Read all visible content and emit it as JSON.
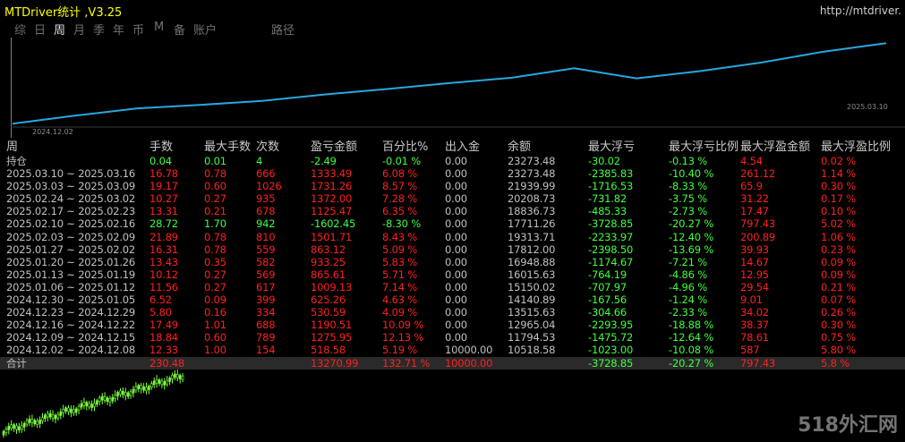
{
  "app": {
    "title": "MTDriver统计 ,V3.25",
    "url": "http://mtdriver."
  },
  "tabs": [
    "综",
    "日",
    "周",
    "月",
    "季",
    "年",
    "币",
    "M",
    "备",
    "账户",
    "路径"
  ],
  "equity_chart": {
    "start_date": "2024.12.02",
    "end_date": "2025.03.10",
    "values": [
      10518.58,
      11794.53,
      12965.04,
      13515.63,
      14140.89,
      15150.02,
      16015.63,
      16948.88,
      17812.0,
      19313.71,
      17711.26,
      18836.73,
      20208.73,
      21939.99,
      23273.48
    ]
  },
  "headers": [
    "周",
    "手数",
    "最大手数",
    "次数",
    "盈亏金额",
    "百分比%",
    "出入金",
    "余额",
    "最大浮亏",
    "最大浮亏比例",
    "最大浮盈金额",
    "最大浮盈比例"
  ],
  "rows": [
    {
      "label": "持仓",
      "v": [
        "0.04",
        "0.01",
        "4",
        "-2.49",
        "-0.01 %",
        "0.00",
        "23273.48",
        "-30.02",
        "-0.13 %",
        "4.54",
        "0.02 %"
      ]
    },
    {
      "label": "2025.03.10 ~ 2025.03.16",
      "v": [
        "16.78",
        "0.78",
        "666",
        "1333.49",
        "6.08 %",
        "0.00",
        "23273.48",
        "-2385.83",
        "-10.40 %",
        "261.12",
        "1.14 %"
      ]
    },
    {
      "label": "2025.03.03 ~ 2025.03.09",
      "v": [
        "19.17",
        "0.60",
        "1026",
        "1731.26",
        "8.57 %",
        "0.00",
        "21939.99",
        "-1716.53",
        "-8.33 %",
        "65.9",
        "0.30 %"
      ]
    },
    {
      "label": "2025.02.24 ~ 2025.03.02",
      "v": [
        "10.27",
        "0.27",
        "935",
        "1372.00",
        "7.28 %",
        "0.00",
        "20208.73",
        "-731.82",
        "-3.75 %",
        "31.22",
        "0.17 %"
      ]
    },
    {
      "label": "2025.02.17 ~ 2025.02.23",
      "v": [
        "13.31",
        "0.21",
        "678",
        "1125.47",
        "6.35 %",
        "0.00",
        "18836.73",
        "-485.33",
        "-2.73 %",
        "17.47",
        "0.10 %"
      ]
    },
    {
      "label": "2025.02.10 ~ 2025.02.16",
      "v": [
        "28.72",
        "1.70",
        "942",
        "-1602.45",
        "-8.30 %",
        "0.00",
        "17711.26",
        "-3728.85",
        "-20.27 %",
        "797.43",
        "5.02 %"
      ]
    },
    {
      "label": "2025.02.03 ~ 2025.02.09",
      "v": [
        "21.89",
        "0.78",
        "810",
        "1501.71",
        "8.43 %",
        "0.00",
        "19313.71",
        "-2233.97",
        "-12.40 %",
        "200.89",
        "1.06 %"
      ]
    },
    {
      "label": "2025.01.27 ~ 2025.02.02",
      "v": [
        "16.31",
        "0.78",
        "559",
        "863.12",
        "5.09 %",
        "0.00",
        "17812.00",
        "-2398.50",
        "-13.69 %",
        "39.93",
        "0.23 %"
      ]
    },
    {
      "label": "2025.01.20 ~ 2025.01.26",
      "v": [
        "13.43",
        "0.35",
        "582",
        "933.25",
        "5.83 %",
        "0.00",
        "16948.88",
        "-1174.67",
        "-7.21 %",
        "14.67",
        "0.09 %"
      ]
    },
    {
      "label": "2025.01.13 ~ 2025.01.19",
      "v": [
        "10.12",
        "0.27",
        "569",
        "865.61",
        "5.71 %",
        "0.00",
        "16015.63",
        "-764.19",
        "-4.86 %",
        "12.95",
        "0.09 %"
      ]
    },
    {
      "label": "2025.01.06 ~ 2025.01.12",
      "v": [
        "11.56",
        "0.27",
        "617",
        "1009.13",
        "7.14 %",
        "0.00",
        "15150.02",
        "-707.97",
        "-4.96 %",
        "29.54",
        "0.21 %"
      ]
    },
    {
      "label": "2024.12.30 ~ 2025.01.05",
      "v": [
        "6.52",
        "0.09",
        "399",
        "625.26",
        "4.63 %",
        "0.00",
        "14140.89",
        "-167.56",
        "-1.24 %",
        "9.01",
        "0.07 %"
      ]
    },
    {
      "label": "2024.12.23 ~ 2024.12.29",
      "v": [
        "5.80",
        "0.16",
        "334",
        "530.59",
        "4.09 %",
        "0.00",
        "13515.63",
        "-304.66",
        "-2.33 %",
        "34.02",
        "0.26 %"
      ]
    },
    {
      "label": "2024.12.16 ~ 2024.12.22",
      "v": [
        "17.49",
        "1.01",
        "688",
        "1190.51",
        "10.09 %",
        "0.00",
        "12965.04",
        "-2293.95",
        "-18.88 %",
        "38.37",
        "0.30 %"
      ]
    },
    {
      "label": "2024.12.09 ~ 2024.12.15",
      "v": [
        "18.84",
        "0.60",
        "789",
        "1275.95",
        "12.13 %",
        "0.00",
        "11794.53",
        "-1475.72",
        "-12.64 %",
        "78.61",
        "0.75 %"
      ]
    },
    {
      "label": "2024.12.02 ~ 2024.12.08",
      "v": [
        "12.33",
        "1.00",
        "154",
        "518.58",
        "5.19 %",
        "10000.00",
        "10518.58",
        "-1023.00",
        "-10.08 %",
        "587",
        "5.80 %"
      ]
    }
  ],
  "total": {
    "label": "合计",
    "v": [
      "230.48",
      "",
      "",
      "13270.99",
      "132.71 %",
      "10000.00",
      "",
      "-3728.85",
      "-20.27 %",
      "797.43",
      "5.8 %"
    ]
  },
  "colors": {
    "positive": "#ff2020",
    "negative": "#40ff40",
    "neutral": "#c0c0c0",
    "equity_line": "#2aa6e0",
    "candle": "#7cff3c"
  },
  "watermark": "518外汇网"
}
